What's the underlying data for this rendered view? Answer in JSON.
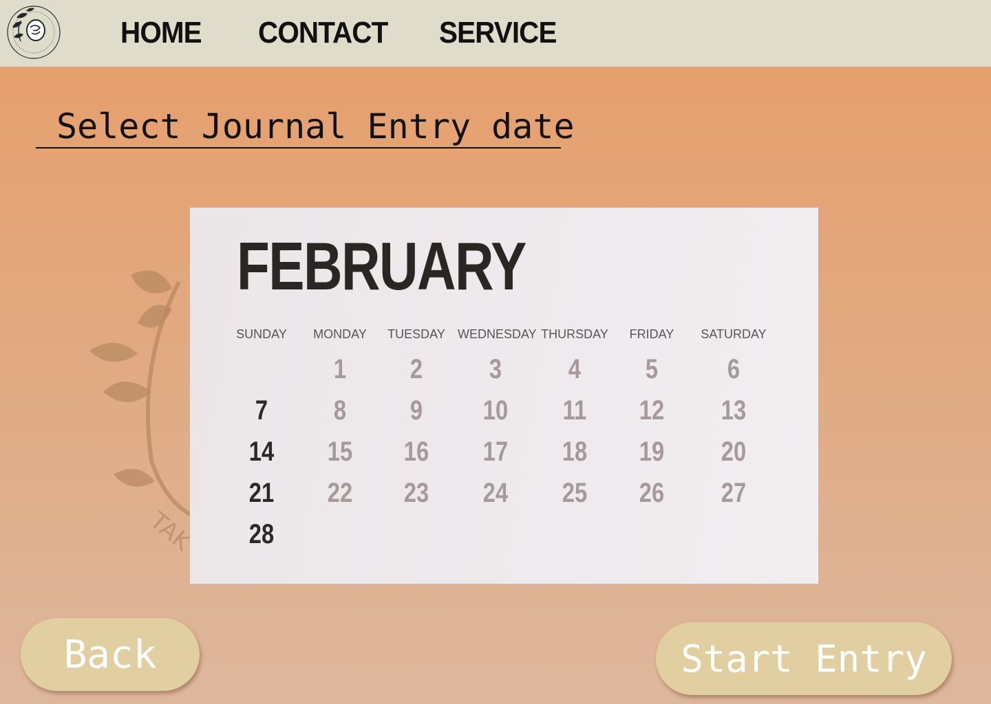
{
  "nav": {
    "home": "HOME",
    "contact": "CONTACT",
    "service": "SERVICE"
  },
  "logo": {
    "text": "TAKE CARE OF YOUR MENTAL HEALTH",
    "icon": "leaf-wreath-logo"
  },
  "page": {
    "title": "Select Journal Entry date"
  },
  "calendar": {
    "month": "FEBRUARY",
    "weekdays": [
      "SUNDAY",
      "MONDAY",
      "TUESDAY",
      "WEDNESDAY",
      "THURSDAY",
      "FRIDAY",
      "SATURDAY"
    ],
    "weeks": [
      [
        "",
        "1",
        "2",
        "3",
        "4",
        "5",
        "6"
      ],
      [
        "7",
        "8",
        "9",
        "10",
        "11",
        "12",
        "13"
      ],
      [
        "14",
        "15",
        "16",
        "17",
        "18",
        "19",
        "20"
      ],
      [
        "21",
        "22",
        "23",
        "24",
        "25",
        "26",
        "27"
      ],
      [
        "28",
        "",
        "",
        "",
        "",
        "",
        ""
      ]
    ]
  },
  "buttons": {
    "back": "Back",
    "start_entry": "Start Entry"
  },
  "colors": {
    "topbar": "#e0dccc",
    "button": "#e2cfa1",
    "background_top": "#e89d69",
    "background_bottom": "#ddb79d"
  }
}
